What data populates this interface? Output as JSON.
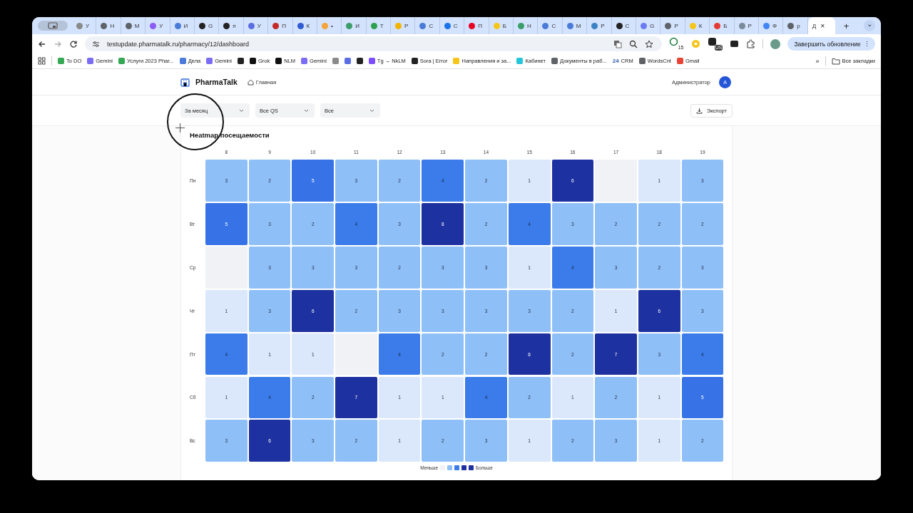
{
  "browser": {
    "tabs": [
      {
        "label": "У",
        "color": "#8a8a8a",
        "selected": false
      },
      {
        "label": "Н",
        "color": "#5f6368",
        "selected": false
      },
      {
        "label": "М",
        "color": "#5f6368",
        "selected": false
      },
      {
        "label": "У",
        "color": "#8b5cf6",
        "selected": false
      },
      {
        "label": "И",
        "color": "#4a7bd8",
        "selected": false
      },
      {
        "label": "G",
        "color": "#222222",
        "selected": false
      },
      {
        "label": "п",
        "color": "#222222",
        "selected": false
      },
      {
        "label": "У",
        "color": "#5b6ee1",
        "selected": false
      },
      {
        "label": "П",
        "color": "#c62828",
        "selected": false
      },
      {
        "label": "К",
        "color": "#2f5bd3",
        "selected": false
      },
      {
        "label": "•",
        "color": "#f4a43a",
        "selected": false
      },
      {
        "label": "И",
        "color": "#3a9d6a",
        "selected": false
      },
      {
        "label": "Т",
        "color": "#2e9e4f",
        "selected": false
      },
      {
        "label": "Р",
        "color": "#f2b300",
        "selected": false
      },
      {
        "label": "С",
        "color": "#4a7bd8",
        "selected": false
      },
      {
        "label": "С",
        "color": "#1a73e8",
        "selected": false
      },
      {
        "label": "П",
        "color": "#e60023",
        "selected": false
      },
      {
        "label": "Б",
        "color": "#f5c518",
        "selected": false
      },
      {
        "label": "Н",
        "color": "#3a9d6a",
        "selected": false
      },
      {
        "label": "С",
        "color": "#4a7bd8",
        "selected": false
      },
      {
        "label": "М",
        "color": "#4a7bd8",
        "selected": false
      },
      {
        "label": "Р",
        "color": "#3b82c4",
        "selected": false
      },
      {
        "label": "С",
        "color": "#222222",
        "selected": false
      },
      {
        "label": "G",
        "color": "#6b7cf0",
        "selected": false
      },
      {
        "label": "Р",
        "color": "#5f6368",
        "selected": false
      },
      {
        "label": "К",
        "color": "#f5c518",
        "selected": false
      },
      {
        "label": "Б",
        "color": "#e53935",
        "selected": false
      },
      {
        "label": "Р",
        "color": "#7a8a99",
        "selected": false
      },
      {
        "label": "Ф",
        "color": "#4285f4",
        "selected": false
      },
      {
        "label": "р",
        "color": "#5f6368",
        "selected": false
      },
      {
        "label": "Д",
        "selected": true
      }
    ],
    "close_tab": "✕",
    "new_tab": "+",
    "tab_menu": "⌄",
    "menu_dots": "⋮",
    "url": "testupdate.pharmatalk.ru/pharmacy/12/dashboard",
    "extension_badges": [
      "15",
      "US"
    ],
    "update_button": "Завершить обновление",
    "bookmarks": [
      {
        "label": "To DO",
        "color": "#34a853"
      },
      {
        "label": "Gemini",
        "color": "#7b6cf6"
      },
      {
        "label": "Услуги 2023 Phar...",
        "color": "#34a853"
      },
      {
        "label": "Дела",
        "color": "#4a7bd8"
      },
      {
        "label": "Gemini",
        "color": "#7b6cf6"
      },
      {
        "color": "#222222"
      },
      {
        "label": "Grok",
        "color": "#111111"
      },
      {
        "label": "NLM",
        "color": "#111111"
      },
      {
        "label": "Gemini",
        "color": "#7b6cf6"
      },
      {
        "color": "#8a8a8a"
      },
      {
        "color": "#5b6ee1"
      },
      {
        "color": "#222222"
      },
      {
        "label": "Tg → NkLM",
        "color": "#7c4dff"
      },
      {
        "label": "Sora | Error",
        "color": "#222222"
      },
      {
        "label": "Направления и за...",
        "color": "#f5c518"
      },
      {
        "label": "Кабинет",
        "color": "#26c6da"
      },
      {
        "label": "Документы в раб...",
        "color": "#5f6368"
      },
      {
        "label": "CRM",
        "color": "#2e5aac"
      },
      {
        "label": "WordsCnt",
        "color": "#5f6368"
      },
      {
        "label": "Gmail",
        "color": "#ea4335"
      }
    ],
    "crm_logo": "24",
    "more": "»",
    "all_bookmarks": "Все закладки"
  },
  "app": {
    "brand": "PharmaTalk",
    "nav": [
      "Главная"
    ],
    "user": "Администратор",
    "avatar": "А",
    "filters": [
      "За месяц",
      "Все QS",
      "Все"
    ],
    "export": "Экспорт",
    "heatmap": {
      "title": "Heatmap посещаемости",
      "hours": [
        "8",
        "9",
        "10",
        "11",
        "12",
        "13",
        "14",
        "15",
        "16",
        "17",
        "18",
        "19"
      ],
      "rows": [
        {
          "day": "Пн",
          "cells": [
            {
              "value": "3",
              "color": "#8fbff7"
            },
            {
              "value": "2",
              "color": "#8fbff7"
            },
            {
              "value": "5",
              "color": "#3773e6"
            },
            {
              "value": "3",
              "color": "#8fbff7"
            },
            {
              "value": "2",
              "color": "#8fbff7"
            },
            {
              "value": "4",
              "color": "#3b7bea"
            },
            {
              "value": "2",
              "color": "#8fbff7"
            },
            {
              "value": "1",
              "color": "#dbe8fb"
            },
            {
              "value": "6",
              "color": "#1e31a0"
            },
            {
              "color": "#f1f2f5"
            },
            {
              "value": "1",
              "color": "#dbe8fb"
            },
            {
              "value": "3",
              "color": "#8fbff7"
            }
          ]
        },
        {
          "day": "Вт",
          "cells": [
            {
              "value": "5",
              "color": "#3773e6"
            },
            {
              "value": "3",
              "color": "#8fbff7"
            },
            {
              "value": "2",
              "color": "#8fbff7"
            },
            {
              "value": "4",
              "color": "#3b7bea"
            },
            {
              "value": "3",
              "color": "#8fbff7"
            },
            {
              "value": "8",
              "color": "#1e31a0"
            },
            {
              "value": "2",
              "color": "#8fbff7"
            },
            {
              "value": "4",
              "color": "#3b7bea"
            },
            {
              "value": "3",
              "color": "#8fbff7"
            },
            {
              "value": "2",
              "color": "#8fbff7"
            },
            {
              "value": "2",
              "color": "#8fbff7"
            },
            {
              "value": "2",
              "color": "#8fbff7"
            }
          ]
        },
        {
          "day": "Ср",
          "cells": [
            {
              "color": "#f1f2f5"
            },
            {
              "value": "3",
              "color": "#8fbff7"
            },
            {
              "value": "3",
              "color": "#8fbff7"
            },
            {
              "value": "3",
              "color": "#8fbff7"
            },
            {
              "value": "2",
              "color": "#8fbff7"
            },
            {
              "value": "3",
              "color": "#8fbff7"
            },
            {
              "value": "3",
              "color": "#8fbff7"
            },
            {
              "value": "1",
              "color": "#dbe8fb"
            },
            {
              "value": "4",
              "color": "#3b7bea"
            },
            {
              "value": "3",
              "color": "#8fbff7"
            },
            {
              "value": "2",
              "color": "#8fbff7"
            },
            {
              "value": "3",
              "color": "#8fbff7"
            }
          ]
        },
        {
          "day": "Чт",
          "cells": [
            {
              "value": "1",
              "color": "#dbe8fb"
            },
            {
              "value": "3",
              "color": "#8fbff7"
            },
            {
              "value": "6",
              "color": "#1e31a0"
            },
            {
              "value": "2",
              "color": "#8fbff7"
            },
            {
              "value": "3",
              "color": "#8fbff7"
            },
            {
              "value": "3",
              "color": "#8fbff7"
            },
            {
              "value": "3",
              "color": "#8fbff7"
            },
            {
              "value": "3",
              "color": "#8fbff7"
            },
            {
              "value": "2",
              "color": "#8fbff7"
            },
            {
              "value": "1",
              "color": "#dbe8fb"
            },
            {
              "value": "6",
              "color": "#1e31a0"
            },
            {
              "value": "3",
              "color": "#8fbff7"
            }
          ]
        },
        {
          "day": "Пт",
          "cells": [
            {
              "value": "4",
              "color": "#3b7bea"
            },
            {
              "value": "1",
              "color": "#dbe8fb"
            },
            {
              "value": "1",
              "color": "#dbe8fb"
            },
            {
              "color": "#f1f2f5"
            },
            {
              "value": "4",
              "color": "#3b7bea"
            },
            {
              "value": "2",
              "color": "#8fbff7"
            },
            {
              "value": "2",
              "color": "#8fbff7"
            },
            {
              "value": "6",
              "color": "#1e31a0"
            },
            {
              "value": "2",
              "color": "#8fbff7"
            },
            {
              "value": "7",
              "color": "#1e31a0"
            },
            {
              "value": "3",
              "color": "#8fbff7"
            },
            {
              "value": "4",
              "color": "#3b7bea"
            }
          ]
        },
        {
          "day": "Сб",
          "cells": [
            {
              "value": "1",
              "color": "#dbe8fb"
            },
            {
              "value": "4",
              "color": "#3b7bea"
            },
            {
              "value": "2",
              "color": "#8fbff7"
            },
            {
              "value": "7",
              "color": "#1e31a0"
            },
            {
              "value": "1",
              "color": "#dbe8fb"
            },
            {
              "value": "1",
              "color": "#dbe8fb"
            },
            {
              "value": "4",
              "color": "#3b7bea"
            },
            {
              "value": "2",
              "color": "#8fbff7"
            },
            {
              "value": "1",
              "color": "#dbe8fb"
            },
            {
              "value": "2",
              "color": "#8fbff7"
            },
            {
              "value": "1",
              "color": "#dbe8fb"
            },
            {
              "value": "5",
              "color": "#3773e6"
            }
          ]
        },
        {
          "day": "Вс",
          "cells": [
            {
              "value": "3",
              "color": "#8fbff7"
            },
            {
              "value": "6",
              "color": "#1e31a0"
            },
            {
              "value": "3",
              "color": "#8fbff7"
            },
            {
              "value": "2",
              "color": "#8fbff7"
            },
            {
              "value": "1",
              "color": "#dbe8fb"
            },
            {
              "value": "2",
              "color": "#8fbff7"
            },
            {
              "value": "3",
              "color": "#8fbff7"
            },
            {
              "value": "1",
              "color": "#dbe8fb"
            },
            {
              "value": "2",
              "color": "#8fbff7"
            },
            {
              "value": "3",
              "color": "#8fbff7"
            },
            {
              "value": "1",
              "color": "#dbe8fb"
            },
            {
              "value": "2",
              "color": "#8fbff7"
            }
          ]
        }
      ],
      "legend": {
        "less": "Меньше",
        "more": "Больше",
        "swatches": [
          {
            "color": "#f1f2f5"
          },
          {
            "color": "#8fbff7"
          },
          {
            "color": "#3b7bea"
          },
          {
            "color": "#1e31a0"
          },
          {
            "color": "#1e31a0"
          }
        ]
      }
    }
  }
}
